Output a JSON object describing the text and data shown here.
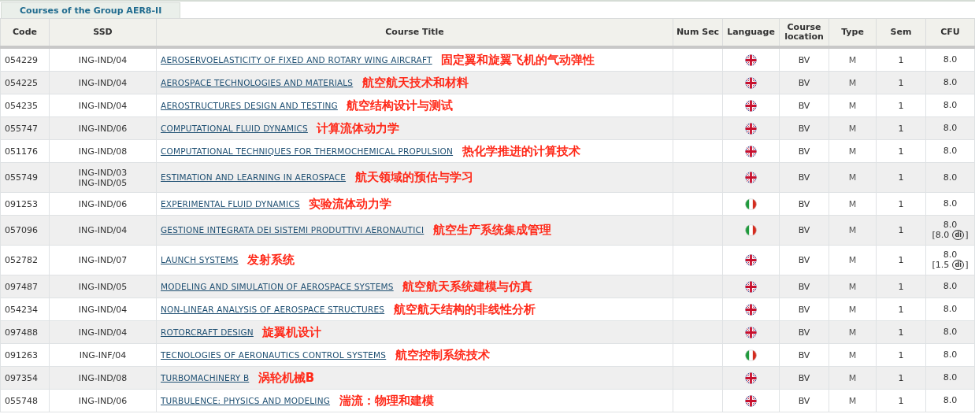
{
  "tab": {
    "label": "Courses of the Group AER8-II",
    "selected": true
  },
  "columns": [
    "Code",
    "SSD",
    "Course Title",
    "Num Sec",
    "Language",
    "Course location",
    "Type",
    "Sem",
    "CFU"
  ],
  "rows": [
    {
      "code": "054229",
      "ssd": [
        "ING-IND/04"
      ],
      "title": "AEROSERVOELASTICITY OF FIXED AND ROTARY WING AIRCRAFT",
      "annotation": "固定翼和旋翼飞机的气动弹性",
      "flag": {
        "kind": "uk"
      },
      "location": "BV",
      "type": "M",
      "sem": "1",
      "cfu": "8.0"
    },
    {
      "code": "054225",
      "ssd": [
        "ING-IND/04"
      ],
      "title": "AEROSPACE TECHNOLOGIES AND MATERIALS",
      "annotation": "航空航天技术和材料",
      "flag": {
        "kind": "uk"
      },
      "location": "BV",
      "type": "M",
      "sem": "1",
      "cfu": "8.0"
    },
    {
      "code": "054235",
      "ssd": [
        "ING-IND/04"
      ],
      "title": "AEROSTRUCTURES DESIGN AND TESTING",
      "annotation": "航空结构设计与测试",
      "flag": {
        "kind": "uk"
      },
      "location": "BV",
      "type": "M",
      "sem": "1",
      "cfu": "8.0"
    },
    {
      "code": "055747",
      "ssd": [
        "ING-IND/06"
      ],
      "title": "COMPUTATIONAL FLUID DYNAMICS",
      "annotation": "计算流体动力学",
      "flag": {
        "kind": "uk"
      },
      "location": "BV",
      "type": "M",
      "sem": "1",
      "cfu": "8.0"
    },
    {
      "code": "051176",
      "ssd": [
        "ING-IND/08"
      ],
      "title": "COMPUTATIONAL TECHNIQUES FOR THERMOCHEMICAL PROPULSION",
      "annotation": "热化学推进的计算技术",
      "flag": {
        "kind": "uk"
      },
      "location": "BV",
      "type": "M",
      "sem": "1",
      "cfu": "8.0"
    },
    {
      "code": "055749",
      "ssd": [
        "ING-IND/03",
        "ING-IND/05"
      ],
      "title": "ESTIMATION AND LEARNING IN AEROSPACE",
      "annotation": "航天领域的预估与学习",
      "flag": {
        "kind": "uk"
      },
      "location": "BV",
      "type": "M",
      "sem": "1",
      "cfu": "8.0"
    },
    {
      "code": "091253",
      "ssd": [
        "ING-IND/06"
      ],
      "title": "EXPERIMENTAL FLUID DYNAMICS",
      "annotation": "实验流体动力学",
      "flag": {
        "kind": "italy"
      },
      "location": "BV",
      "type": "M",
      "sem": "1",
      "cfu": "8.0"
    },
    {
      "code": "057096",
      "ssd": [
        "ING-IND/04"
      ],
      "title": "GESTIONE INTEGRATA DEI SISTEMI PRODUTTIVI AERONAUTICI",
      "annotation": "航空生产系统集成管理",
      "flag": {
        "kind": "italy"
      },
      "location": "BV",
      "type": "M",
      "sem": "1",
      "cfu": "8.0",
      "cfu_note": {
        "open": "[8.0",
        "badge": "di",
        "close": "]"
      }
    },
    {
      "code": "052782",
      "ssd": [
        "ING-IND/07"
      ],
      "title": "LAUNCH SYSTEMS",
      "annotation": "发射系统",
      "flag": {
        "kind": "uk"
      },
      "location": "BV",
      "type": "M",
      "sem": "1",
      "cfu": "8.0",
      "cfu_note": {
        "open": "[1.5",
        "badge": "di",
        "close": "]"
      }
    },
    {
      "code": "097487",
      "ssd": [
        "ING-IND/05"
      ],
      "title": "MODELING AND SIMULATION OF AEROSPACE SYSTEMS",
      "annotation": "航空航天系统建模与仿真",
      "flag": {
        "kind": "uk"
      },
      "location": "BV",
      "type": "M",
      "sem": "1",
      "cfu": "8.0"
    },
    {
      "code": "054234",
      "ssd": [
        "ING-IND/04"
      ],
      "title": "NON-LINEAR ANALYSIS OF AEROSPACE STRUCTURES",
      "annotation": "航空航天结构的非线性分析",
      "flag": {
        "kind": "uk"
      },
      "location": "BV",
      "type": "M",
      "sem": "1",
      "cfu": "8.0"
    },
    {
      "code": "097488",
      "ssd": [
        "ING-IND/04"
      ],
      "title": "ROTORCRAFT DESIGN",
      "annotation": "旋翼机设计",
      "flag": {
        "kind": "uk"
      },
      "location": "BV",
      "type": "M",
      "sem": "1",
      "cfu": "8.0"
    },
    {
      "code": "091263",
      "ssd": [
        "ING-INF/04"
      ],
      "title": "TECNOLOGIES OF AERONAUTICS CONTROL SYSTEMS",
      "annotation": "航空控制系统技术",
      "flag": {
        "kind": "italy"
      },
      "location": "BV",
      "type": "M",
      "sem": "1",
      "cfu": "8.0"
    },
    {
      "code": "097354",
      "ssd": [
        "ING-IND/08"
      ],
      "title": "TURBOMACHINERY B",
      "annotation": "涡轮机械B",
      "flag": {
        "kind": "uk"
      },
      "location": "BV",
      "type": "M",
      "sem": "1",
      "cfu": "8.0"
    },
    {
      "code": "055748",
      "ssd": [
        "ING-IND/06"
      ],
      "title": "TURBULENCE: PHYSICS AND MODELING",
      "annotation": "湍流：物理和建模",
      "flag": {
        "kind": "uk"
      },
      "location": "BV",
      "type": "M",
      "sem": "1",
      "cfu": "8.0"
    }
  ]
}
